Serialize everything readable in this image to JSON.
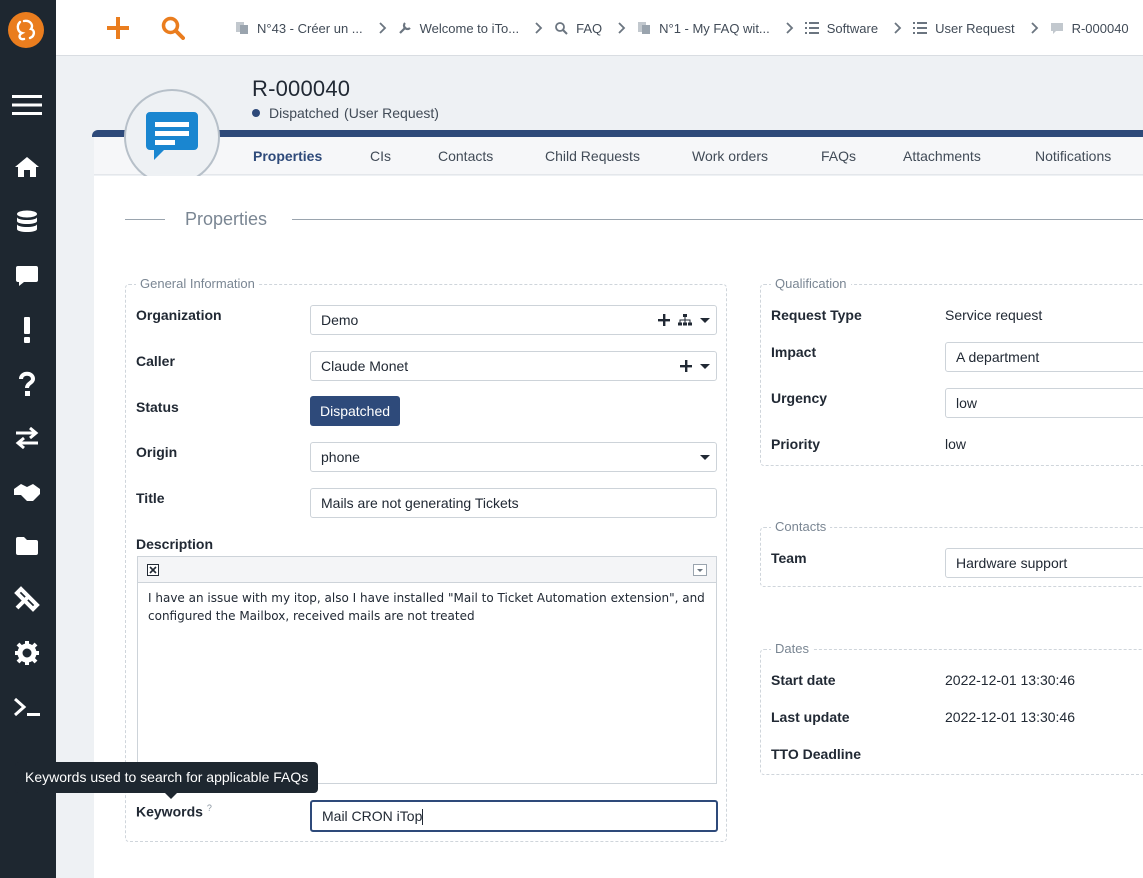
{
  "app": {
    "logo": "itop-logo"
  },
  "sidebar": {
    "items": [
      {
        "icon": "menu-icon"
      },
      {
        "icon": "home-icon"
      },
      {
        "icon": "database-icon"
      },
      {
        "icon": "chat-icon"
      },
      {
        "icon": "exclamation-icon"
      },
      {
        "icon": "question-icon"
      },
      {
        "icon": "exchange-icon"
      },
      {
        "icon": "handshake-icon"
      },
      {
        "icon": "folder-icon"
      },
      {
        "icon": "tools-icon"
      },
      {
        "icon": "gear-icon"
      },
      {
        "icon": "terminal-icon"
      }
    ]
  },
  "topbar": {
    "breadcrumbs": [
      {
        "label": "N°43 - Créer un ...",
        "icon": "faq-doc-icon"
      },
      {
        "label": "Welcome to iTo...",
        "icon": "wrench-icon"
      },
      {
        "label": "FAQ",
        "icon": "search-icon"
      },
      {
        "label": "N°1 - My FAQ wit...",
        "icon": "faq-doc-icon"
      },
      {
        "label": "Software",
        "icon": "list-icon"
      },
      {
        "label": "User Request",
        "icon": "list-icon"
      },
      {
        "label": "R-000040",
        "icon": "ticket-icon"
      }
    ]
  },
  "object": {
    "ref": "R-000040",
    "status": "Dispatched",
    "class": "(User Request)"
  },
  "tabs": [
    "Properties",
    "CIs",
    "Contacts",
    "Child Requests",
    "Work orders",
    "FAQs",
    "Attachments",
    "Notifications"
  ],
  "section_title": "Properties",
  "general": {
    "legend": "General Information",
    "organization_label": "Organization",
    "organization_value": "Demo",
    "caller_label": "Caller",
    "caller_value": "Claude Monet",
    "status_label": "Status",
    "status_value": "Dispatched",
    "origin_label": "Origin",
    "origin_value": "phone",
    "title_label": "Title",
    "title_value": "Mails are not generating Tickets",
    "description_label": "Description",
    "description_value": "I have an issue with my itop, also I have installed \"Mail to Ticket Automation extension\", and configured the Mailbox, received mails are not treated",
    "keywords_label": "Keywords",
    "keywords_help": "?",
    "keywords_value": "Mail CRON iTop",
    "keywords_tooltip": "Keywords used to search for applicable FAQs"
  },
  "qualification": {
    "legend": "Qualification",
    "request_type_label": "Request Type",
    "request_type_value": "Service request",
    "impact_label": "Impact",
    "impact_value": "A department",
    "urgency_label": "Urgency",
    "urgency_value": "low",
    "priority_label": "Priority",
    "priority_value": "low"
  },
  "contacts": {
    "legend": "Contacts",
    "team_label": "Team",
    "team_value": "Hardware support"
  },
  "dates": {
    "legend": "Dates",
    "start_label": "Start date",
    "start_value": "2022-12-01 13:30:46",
    "update_label": "Last update",
    "update_value": "2022-12-01 13:30:46",
    "tto_label": "TTO Deadline"
  },
  "colors": {
    "brand": "#ea7d1e",
    "sidebar": "#1e2730",
    "accent": "#2e4a7a"
  }
}
